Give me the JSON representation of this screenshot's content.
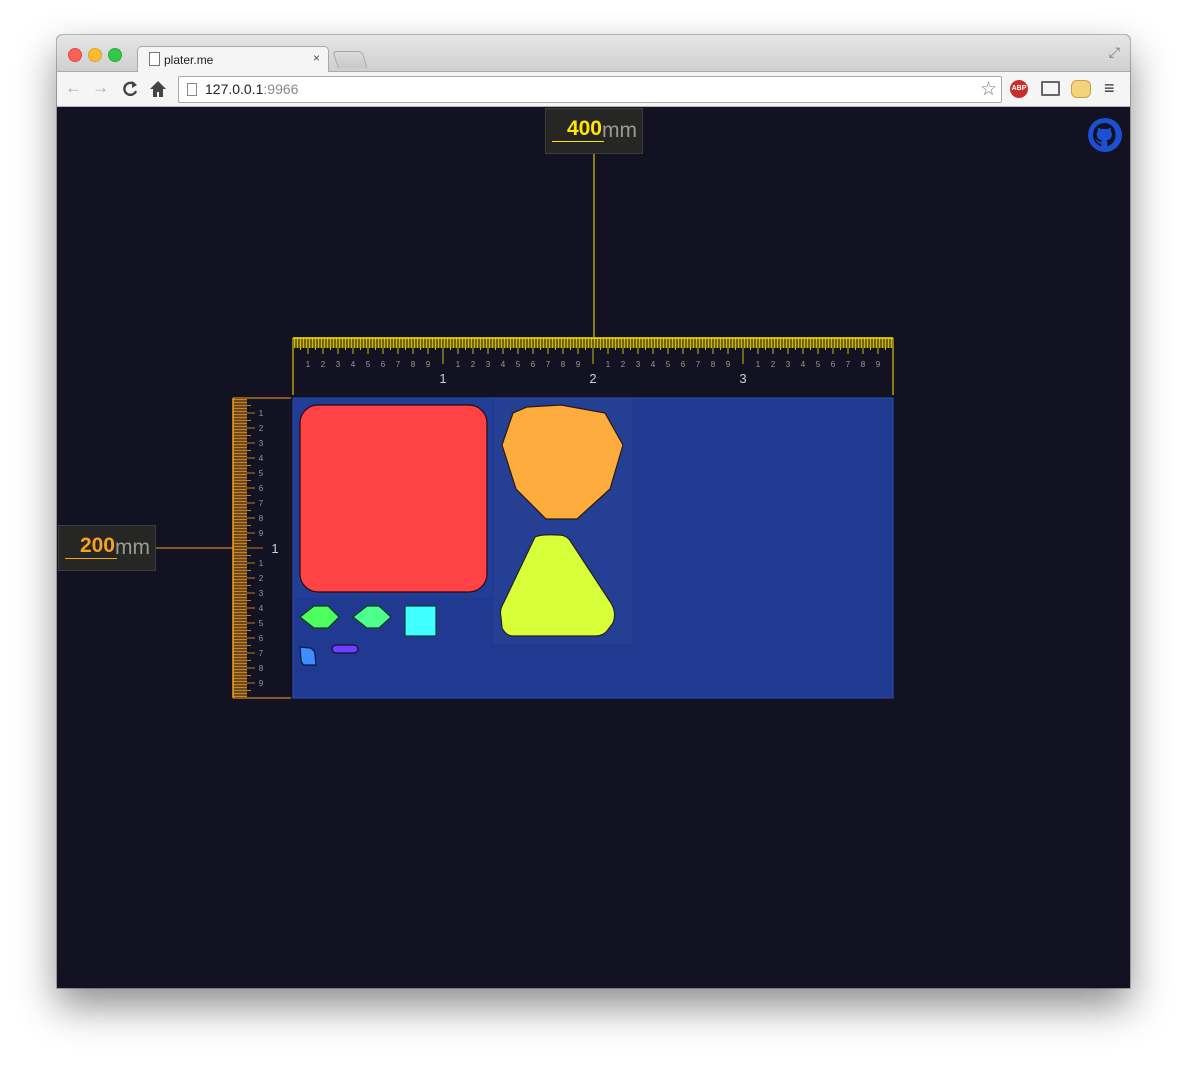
{
  "browser": {
    "tab_title": "plater.me",
    "tab_close": "×",
    "url_host": "127.0.0.1",
    "url_port": ":9966",
    "abp_label": "ABP",
    "back_glyph": "←",
    "forward_glyph": "→",
    "reload_glyph": "C",
    "home_glyph": "⌂",
    "star_glyph": "☆",
    "menu_glyph": "≡",
    "fullscreen_glyph": "⤢"
  },
  "plate": {
    "width": {
      "value": "400",
      "unit": "mm"
    },
    "height": {
      "value": "200",
      "unit": "mm"
    }
  },
  "rulers": {
    "top_major_labels": [
      "1",
      "2",
      "3"
    ],
    "top_minor_labels": [
      "1",
      "2",
      "3",
      "4",
      "5",
      "6",
      "7",
      "8",
      "9"
    ],
    "left_major_labels": [
      "1"
    ],
    "left_minor_labels": [
      "1",
      "2",
      "3",
      "4",
      "5",
      "6",
      "7",
      "8",
      "9"
    ]
  },
  "parts": [
    {
      "name": "rounded-square",
      "color": "#ff4243"
    },
    {
      "name": "octagon",
      "color": "#ffac3f"
    },
    {
      "name": "rounded-triangle",
      "color": "#d7ff3a"
    },
    {
      "name": "diamond-1",
      "color": "#4dff5e"
    },
    {
      "name": "diamond-2",
      "color": "#4dff8c"
    },
    {
      "name": "small-square",
      "color": "#3fffff"
    },
    {
      "name": "small-quad",
      "color": "#3f8cff"
    },
    {
      "name": "pill",
      "color": "#6f3fff"
    }
  ],
  "colors": {
    "plate": "#1f3a90",
    "ruler_x": "#ffe600",
    "ruler_y": "#f8a020",
    "background": "#131222"
  },
  "icons": {
    "github": "github-icon"
  }
}
